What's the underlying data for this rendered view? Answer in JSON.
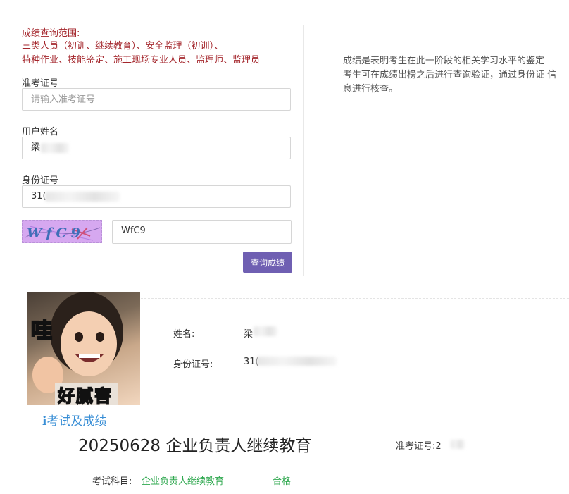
{
  "scope": {
    "title": "成绩查询范围:",
    "line1": "三类人员（初训、继续教育）、安全监理（初训）、",
    "line2": "特种作业、技能鉴定、施工现场专业人员、监理师、监理员"
  },
  "form": {
    "ticket_label": "准考证号",
    "ticket_placeholder": "请输入准考证号",
    "name_label": "用户姓名",
    "name_value": "梁",
    "id_label": "身份证号",
    "id_value": "31(",
    "captcha_image_text": "WfC9",
    "captcha_value": "WfC9",
    "submit_label": "查询成绩"
  },
  "notice": {
    "line1": "成绩是表明考生在此一阶段的相关学习水平的鉴定",
    "line2": "考生可在成绩出榜之后进行查询验证，通过身份证 信息进行核查。"
  },
  "photo": {
    "caption_top": "哇",
    "caption_bottom": "好腻害"
  },
  "result": {
    "name_label": "姓名:",
    "name_value": "梁",
    "id_label": "身份证号:",
    "id_value": "31(",
    "section_icon": "i",
    "section_title": "考试及成绩",
    "exam_name": "20250628 企业负责人继续教育",
    "ticket_label": "准考证号:",
    "ticket_value": "2",
    "subject_label": "考试科目:",
    "subject_value": "企业负责人继续教育",
    "result_value": "合格"
  },
  "colors": {
    "accent_red": "#a4262c",
    "button_purple": "#6f5fb2",
    "link_blue": "#3a8fd6",
    "pass_green": "#2fa84f"
  }
}
